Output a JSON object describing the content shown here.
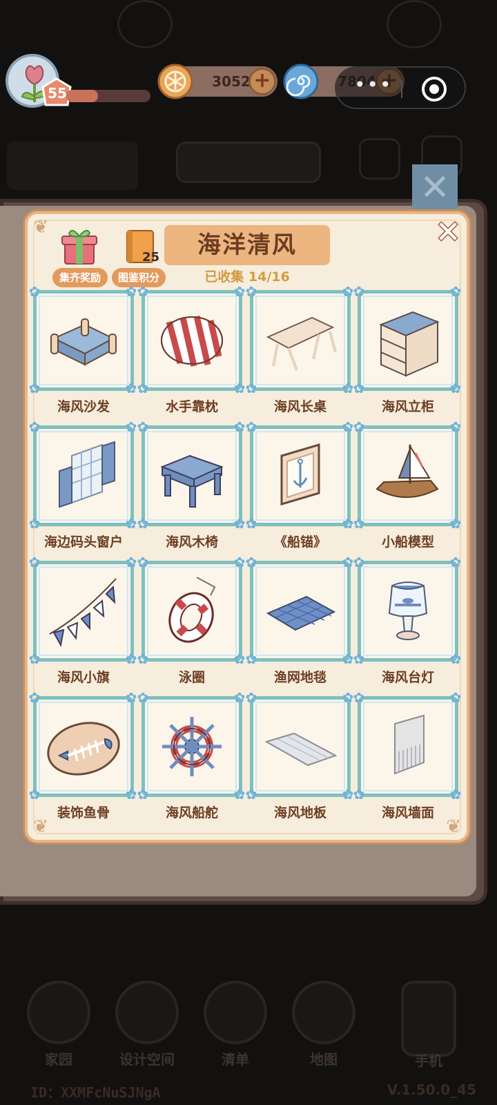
{
  "topbar": {
    "level": "55",
    "xp_fraction": 0.38,
    "coins": "3052",
    "gems": "7804",
    "capsule_dots": "•••"
  },
  "panel": {
    "title": "海洋清风",
    "progress_text": "已收集 14/16",
    "reward_label": "集齐奖励",
    "points_label": "图鉴积分",
    "points_count": "25",
    "close_glyph": "✕"
  },
  "items": [
    {
      "label": "海风沙发",
      "icon": "sofa-icon"
    },
    {
      "label": "水手靠枕",
      "icon": "pillow-icon"
    },
    {
      "label": "海风长桌",
      "icon": "table-icon"
    },
    {
      "label": "海风立柜",
      "icon": "cabinet-icon"
    },
    {
      "label": "海边码头窗户",
      "icon": "window-icon"
    },
    {
      "label": "海风木椅",
      "icon": "stool-icon"
    },
    {
      "label": "《船锚》",
      "icon": "anchor-painting-icon"
    },
    {
      "label": "小船模型",
      "icon": "boat-icon"
    },
    {
      "label": "海风小旗",
      "icon": "bunting-icon"
    },
    {
      "label": "泳圈",
      "icon": "lifebuoy-icon"
    },
    {
      "label": "渔网地毯",
      "icon": "rug-icon"
    },
    {
      "label": "海风台灯",
      "icon": "lamp-icon"
    },
    {
      "label": "装饰鱼骨",
      "icon": "fishbone-icon"
    },
    {
      "label": "海风船舵",
      "icon": "ship-wheel-icon"
    },
    {
      "label": "海风地板",
      "icon": "floor-icon"
    },
    {
      "label": "海风墙面",
      "icon": "wall-icon"
    }
  ],
  "bottom_nav": [
    "家园",
    "设计空间",
    "清单",
    "地图",
    "手机"
  ],
  "footer": {
    "id": "ID：XXMFcNuSJNgA",
    "version": "V.1.50.0_45"
  },
  "colors": {
    "panel_bg": "#f6eddc",
    "frame_border": "#7ec0bc",
    "accent_orange": "#e39a5d",
    "title_bg": "#edb580",
    "progress_text": "#d49a43"
  }
}
